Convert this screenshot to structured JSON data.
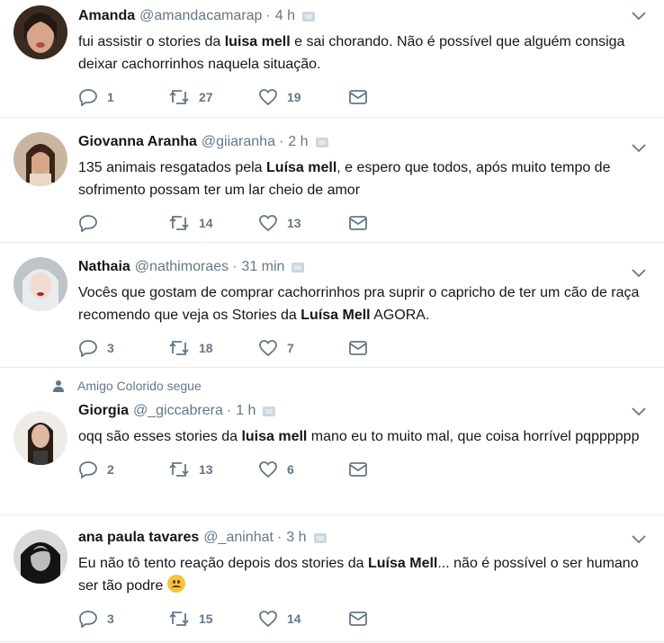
{
  "colors": {
    "text": "#14171a",
    "secondary": "#657786",
    "border": "#e6ecf0"
  },
  "tweets": [
    {
      "name": "Amanda",
      "handle": "@amandacamarap",
      "sep": "·",
      "time": "4 h",
      "text_segments": [
        {
          "t": "fui assistir o stories da ",
          "bold": false
        },
        {
          "t": "luisa mell",
          "bold": true
        },
        {
          "t": " e sai chorando. Não é possível que alguém consiga deixar cachorrinhos naquela situação.",
          "bold": false
        }
      ],
      "replies": "1",
      "retweets": "27",
      "likes": "19"
    },
    {
      "name": "Giovanna Aranha",
      "handle": "@giiaranha",
      "sep": "·",
      "time": "2 h",
      "text_segments": [
        {
          "t": "135 animais resgatados pela ",
          "bold": false
        },
        {
          "t": "Luísa mell",
          "bold": true
        },
        {
          "t": ", e espero que todos, após muito tempo de sofrimento possam ter um lar cheio de amor",
          "bold": false
        }
      ],
      "replies": "",
      "retweets": "14",
      "likes": "13"
    },
    {
      "name": "Nathaia",
      "handle": "@nathimoraes",
      "sep": "·",
      "time": "31 min",
      "text_segments": [
        {
          "t": "Vocês que gostam de comprar cachorrinhos pra suprir o capricho de ter um cão de raça recomendo que veja os Stories da ",
          "bold": false
        },
        {
          "t": "Luísa Mell",
          "bold": true
        },
        {
          "t": " AGORA.",
          "bold": false
        }
      ],
      "replies": "3",
      "retweets": "18",
      "likes": "7"
    },
    {
      "context": "Amigo Colorido segue",
      "name": "Giorgia",
      "handle": "@_giccabrera",
      "sep": "·",
      "time": "1 h",
      "text_segments": [
        {
          "t": "oqq são esses stories da ",
          "bold": false
        },
        {
          "t": "luisa mell",
          "bold": true
        },
        {
          "t": " mano eu to muito mal, que coisa horrível pqpppppp",
          "bold": false
        }
      ],
      "replies": "2",
      "retweets": "13",
      "likes": "6"
    },
    {
      "name": "ana paula tavares",
      "handle": "@_aninhat",
      "sep": "·",
      "time": "3 h",
      "text_segments": [
        {
          "t": "Eu não tô tento reação depois dos stories da ",
          "bold": false
        },
        {
          "t": "Luísa Mell",
          "bold": true
        },
        {
          "t": "... não é possível o ser humano ser tão podre ",
          "bold": false
        }
      ],
      "emoji": "frowning-face-emoji",
      "replies": "3",
      "retweets": "15",
      "likes": "14"
    }
  ]
}
